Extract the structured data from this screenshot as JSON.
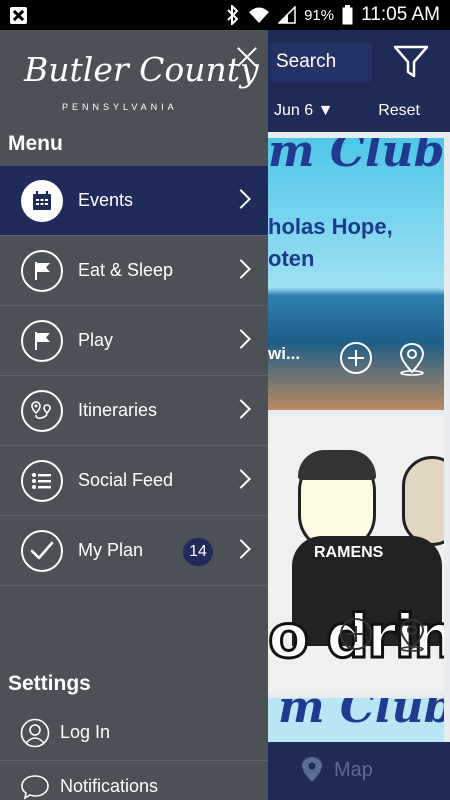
{
  "status_bar": {
    "battery_pct": "91%",
    "time": "11:05 AM",
    "icons": [
      "close-notification-icon",
      "bluetooth-icon",
      "wifi-icon",
      "signal-icon",
      "battery-icon"
    ]
  },
  "background_app": {
    "search_label": "Search",
    "date_label": "Jun 6 ▼",
    "reset_label": "Reset",
    "map_label": "Map",
    "cards": [
      {
        "title_fragment": "m Club",
        "line1": "holas Hope,",
        "line2": "oten",
        "caption": "wi..."
      },
      {
        "shirt_text": "RAMENS",
        "banner_text": "o drin"
      },
      {
        "title_fragment": "m Club"
      }
    ]
  },
  "drawer": {
    "logo_main": "Butler County",
    "logo_sub": "PENNSYLVANIA",
    "menu_title": "Menu",
    "menu_items": [
      {
        "label": "Events",
        "icon": "calendar-icon",
        "active": true
      },
      {
        "label": "Eat & Sleep",
        "icon": "flag-icon",
        "active": false
      },
      {
        "label": "Play",
        "icon": "flag-icon",
        "active": false
      },
      {
        "label": "Itineraries",
        "icon": "map-pin-route-icon",
        "active": false
      },
      {
        "label": "Social Feed",
        "icon": "list-icon",
        "active": false
      },
      {
        "label": "My Plan",
        "icon": "checkmark-icon",
        "active": false,
        "badge": "14"
      }
    ],
    "settings_title": "Settings",
    "settings_items": [
      {
        "label": "Log In",
        "icon": "user-icon"
      },
      {
        "label": "Notifications",
        "icon": "chat-bubble-icon"
      }
    ]
  },
  "colors": {
    "drawer_bg": "#4c5157",
    "active_bg": "#1e2b5b",
    "navy": "#1d2b56"
  }
}
